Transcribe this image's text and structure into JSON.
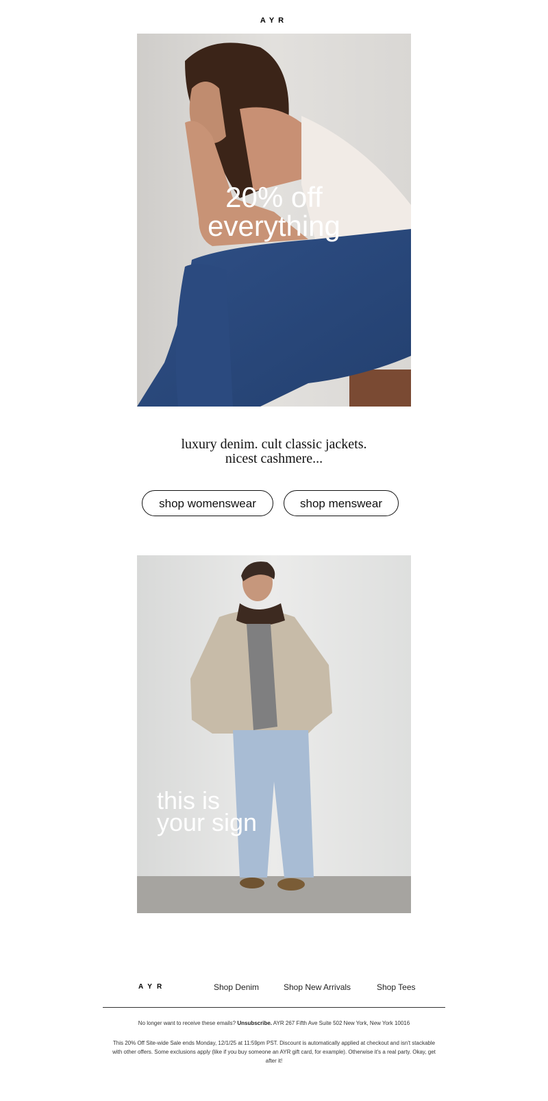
{
  "brand": {
    "logo": "AYR"
  },
  "hero1": {
    "line1": "20% off",
    "line2": "everything"
  },
  "tagline": {
    "line1": "luxury denim. cult classic jackets.",
    "line2": "nicest cashmere..."
  },
  "buttons": {
    "womens": "shop womenswear",
    "mens": "shop menswear"
  },
  "hero2": {
    "line1": "this is",
    "line2": "your sign"
  },
  "footer": {
    "logo": "AYR",
    "links": [
      "Shop Denim",
      "Shop New Arrivals",
      "Shop Tees"
    ],
    "unsub_prefix": "No longer want to receive these emails? ",
    "unsub_link": "Unsubscribe.",
    "address": " AYR 267 Fifth Ave Suite 502 New York, New York 10016",
    "legal": "This 20% Off Site-wide Sale ends Monday, 12/1/25 at 11:59pm PST. Discount is automatically applied at checkout and isn't stackable with other offers. Some exclusions apply (like if you buy someone an AYR gift card, for example).  Otherwise it's a real party. Okay, get after it!"
  },
  "colors": {
    "background": "#ffffff",
    "text": "#111111",
    "overlay_text": "#ffffff"
  }
}
